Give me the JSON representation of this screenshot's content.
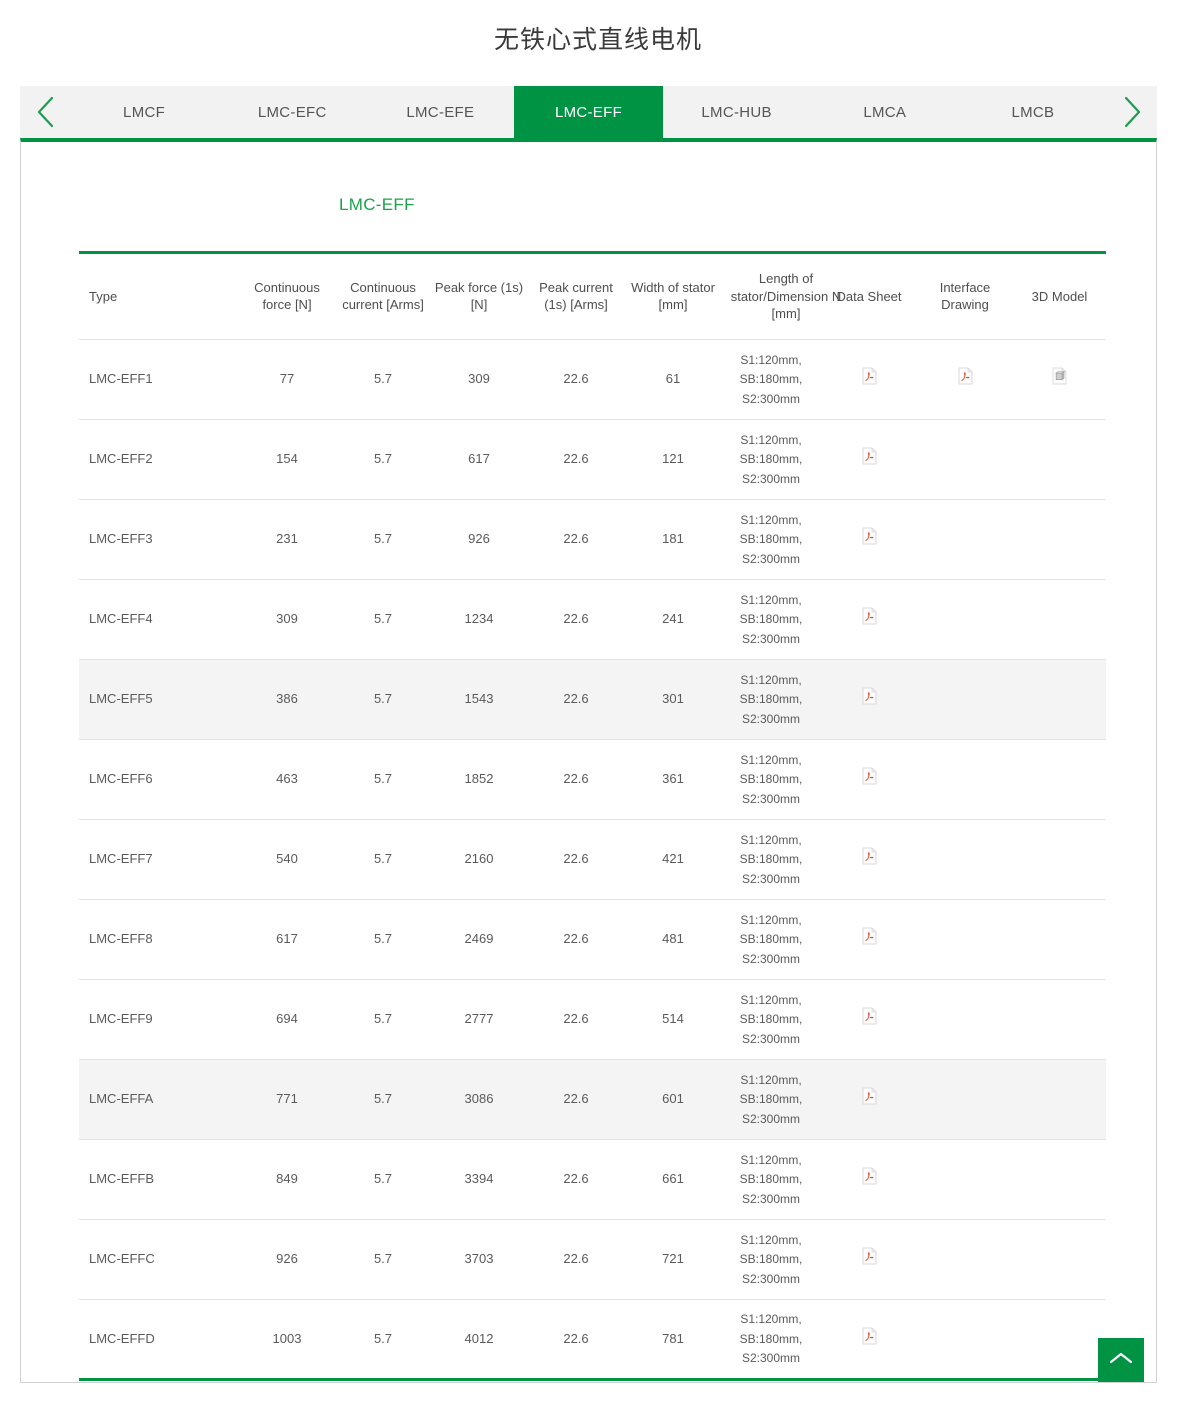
{
  "header": {
    "title": "无铁心式直线电机"
  },
  "tabbar": {
    "prev_label": "‹",
    "next_label": "›",
    "tabs": [
      {
        "label": "LMCF",
        "active": false
      },
      {
        "label": "LMC-EFC",
        "active": false
      },
      {
        "label": "LMC-EFE",
        "active": false
      },
      {
        "label": "LMC-EFF",
        "active": true
      },
      {
        "label": "LMC-HUB",
        "active": false
      },
      {
        "label": "LMCA",
        "active": false
      },
      {
        "label": "LMCB",
        "active": false
      }
    ]
  },
  "panel": {
    "heading": "LMC-EFF"
  },
  "table": {
    "columns": [
      "Type",
      "Continuous force [N]",
      "Continuous current [Arms]",
      "Peak force (1s) [N]",
      "Peak current (1s) [Arms]",
      "Width of stator [mm]",
      "Length of stator/Dimension N [mm]",
      "Data Sheet",
      "Interface Drawing",
      "3D Model"
    ],
    "rows": [
      {
        "type": "LMC-EFF1",
        "continuous_force": "77",
        "continuous_current": "5.7",
        "peak_force": "309",
        "peak_current": "22.6",
        "width_of_stator": "61",
        "length_of_stator": "S1:120mm,\nSB:180mm,\nS2:300mm",
        "data_sheet": "pdf-icon",
        "interface_drawing": "pdf-icon",
        "model_3d": "3d-model-icon"
      },
      {
        "type": "LMC-EFF2",
        "continuous_force": "154",
        "continuous_current": "5.7",
        "peak_force": "617",
        "peak_current": "22.6",
        "width_of_stator": "121",
        "length_of_stator": "S1:120mm,\nSB:180mm,\nS2:300mm",
        "data_sheet": "pdf-icon",
        "interface_drawing": "",
        "model_3d": ""
      },
      {
        "type": "LMC-EFF3",
        "continuous_force": "231",
        "continuous_current": "5.7",
        "peak_force": "926",
        "peak_current": "22.6",
        "width_of_stator": "181",
        "length_of_stator": "S1:120mm,\nSB:180mm,\nS2:300mm",
        "data_sheet": "pdf-icon",
        "interface_drawing": "",
        "model_3d": ""
      },
      {
        "type": "LMC-EFF4",
        "continuous_force": "309",
        "continuous_current": "5.7",
        "peak_force": "1234",
        "peak_current": "22.6",
        "width_of_stator": "241",
        "length_of_stator": "S1:120mm,\nSB:180mm,\nS2:300mm",
        "data_sheet": "pdf-icon",
        "interface_drawing": "",
        "model_3d": ""
      },
      {
        "type": "LMC-EFF5",
        "continuous_force": "386",
        "continuous_current": "5.7",
        "peak_force": "1543",
        "peak_current": "22.6",
        "width_of_stator": "301",
        "length_of_stator": "S1:120mm,\nSB:180mm,\nS2:300mm",
        "data_sheet": "pdf-icon",
        "interface_drawing": "",
        "model_3d": ""
      },
      {
        "type": "LMC-EFF6",
        "continuous_force": "463",
        "continuous_current": "5.7",
        "peak_force": "1852",
        "peak_current": "22.6",
        "width_of_stator": "361",
        "length_of_stator": "S1:120mm,\nSB:180mm,\nS2:300mm",
        "data_sheet": "pdf-icon",
        "interface_drawing": "",
        "model_3d": ""
      },
      {
        "type": "LMC-EFF7",
        "continuous_force": "540",
        "continuous_current": "5.7",
        "peak_force": "2160",
        "peak_current": "22.6",
        "width_of_stator": "421",
        "length_of_stator": "S1:120mm,\nSB:180mm,\nS2:300mm",
        "data_sheet": "pdf-icon",
        "interface_drawing": "",
        "model_3d": ""
      },
      {
        "type": "LMC-EFF8",
        "continuous_force": "617",
        "continuous_current": "5.7",
        "peak_force": "2469",
        "peak_current": "22.6",
        "width_of_stator": "481",
        "length_of_stator": "S1:120mm,\nSB:180mm,\nS2:300mm",
        "data_sheet": "pdf-icon",
        "interface_drawing": "",
        "model_3d": ""
      },
      {
        "type": "LMC-EFF9",
        "continuous_force": "694",
        "continuous_current": "5.7",
        "peak_force": "2777",
        "peak_current": "22.6",
        "width_of_stator": "514",
        "length_of_stator": "S1:120mm,\nSB:180mm,\nS2:300mm",
        "data_sheet": "pdf-icon",
        "interface_drawing": "",
        "model_3d": ""
      },
      {
        "type": "LMC-EFFA",
        "continuous_force": "771",
        "continuous_current": "5.7",
        "peak_force": "3086",
        "peak_current": "22.6",
        "width_of_stator": "601",
        "length_of_stator": "S1:120mm,\nSB:180mm,\nS2:300mm",
        "data_sheet": "pdf-icon",
        "interface_drawing": "",
        "model_3d": ""
      },
      {
        "type": "LMC-EFFB",
        "continuous_force": "849",
        "continuous_current": "5.7",
        "peak_force": "3394",
        "peak_current": "22.6",
        "width_of_stator": "661",
        "length_of_stator": "S1:120mm,\nSB:180mm,\nS2:300mm",
        "data_sheet": "pdf-icon",
        "interface_drawing": "",
        "model_3d": ""
      },
      {
        "type": "LMC-EFFC",
        "continuous_force": "926",
        "continuous_current": "5.7",
        "peak_force": "3703",
        "peak_current": "22.6",
        "width_of_stator": "721",
        "length_of_stator": "S1:120mm,\nSB:180mm,\nS2:300mm",
        "data_sheet": "pdf-icon",
        "interface_drawing": "",
        "model_3d": ""
      },
      {
        "type": "LMC-EFFD",
        "continuous_force": "1003",
        "continuous_current": "5.7",
        "peak_force": "4012",
        "peak_current": "22.6",
        "width_of_stator": "781",
        "length_of_stator": "S1:120mm,\nSB:180mm,\nS2:300mm",
        "data_sheet": "pdf-icon",
        "interface_drawing": "",
        "model_3d": ""
      }
    ],
    "shaded_row_indices": [
      4,
      9
    ]
  },
  "scroll_top_button": {
    "icon": "chevron-up-icon"
  },
  "colors": {
    "brand_green": "#009344",
    "heading_green": "#19a24a",
    "pdf_red": "#e8402a",
    "text_gray": "#5a5a5a",
    "row_shade": "#f4f4f4",
    "tabbar_bg": "#f2f2f2"
  }
}
